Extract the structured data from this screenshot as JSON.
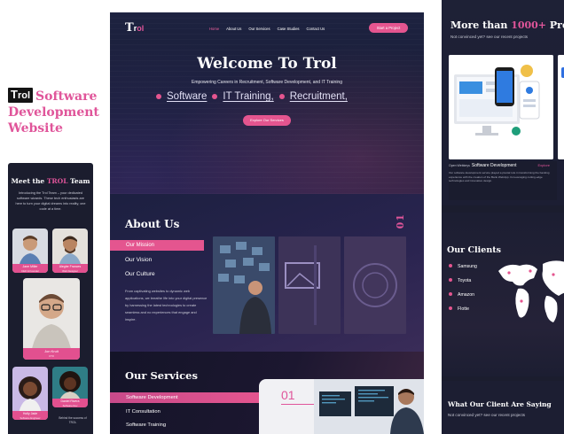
{
  "left_title": {
    "logo_t": "T",
    "logo_rest": "rol",
    "line1": "Software",
    "line2": "Development",
    "line3": "Website"
  },
  "team": {
    "heading_pre": "Meet the",
    "heading_brand": "TROL",
    "heading_post": "Team",
    "intro": "Introducing the Trol Team – your dedicated software wizards. These tech enthusiasts are here to turn your digital dreams into reality, one code at a time.",
    "members": [
      {
        "name": "Jane Miller",
        "role": "CEO & Founder"
      },
      {
        "name": "Alegbe Frances",
        "role": "Web Designer"
      },
      {
        "name": "Jon Kruit",
        "role": "CTO"
      },
      {
        "name": "Holly Jade",
        "role": "Software Engineer"
      },
      {
        "name": "Daniel Rivera",
        "role": "Software Dev"
      }
    ],
    "footer": "Behind the success of TROL"
  },
  "nav": {
    "logo_t": "T",
    "logo_r": "r",
    "logo_rest": "ol",
    "links": [
      "Home",
      "About Us",
      "Our Services",
      "Case Studies",
      "Contact Us"
    ],
    "cta": "Start a Project"
  },
  "hero": {
    "title": "Welcome To Trol",
    "subtitle": "Empowering Careers in Recruitment, Software Development, and IT Training",
    "words": [
      "Software",
      "IT Training,",
      "Recruitment,"
    ],
    "button": "Explore Our Services"
  },
  "about": {
    "title": "About Us",
    "number": "01",
    "tabs": [
      "Our Mission",
      "Our Vision",
      "Our Culture"
    ],
    "description": "From captivating websites to dynamic web applications, we breathe life into your digital presence by harnessing the latest technologies to create seamless and no experiences that engage and inspire."
  },
  "services": {
    "title": "Our Services",
    "items": [
      "Software Development",
      "IT Consultation",
      "Software Training"
    ],
    "number": "01"
  },
  "projects": {
    "title_pre": "More than",
    "title_highlight": "1000+",
    "title_post": "Projects",
    "subtitle": "Not convinced yet? see our recent projects",
    "card_small": "Open Webkeys",
    "card_title": "Software Development",
    "card_link": "Explore",
    "card_desc": "Our software development service played a pivotal role in transforming the banking experience with the creation of the Bank WebApp. Its leveraging cutting-edge technologies and innovative design."
  },
  "clients": {
    "title": "Our Clients",
    "list": [
      "Samsung",
      "Toyota",
      "Amazon",
      "Flotte"
    ]
  },
  "testimonials": {
    "title": "What Our Client Are Saying",
    "subtitle": "Not convinced yet? see our recent projects"
  },
  "colors": {
    "accent": "#e4558f",
    "dark": "#1b1d2e",
    "navy": "#1d2240"
  }
}
